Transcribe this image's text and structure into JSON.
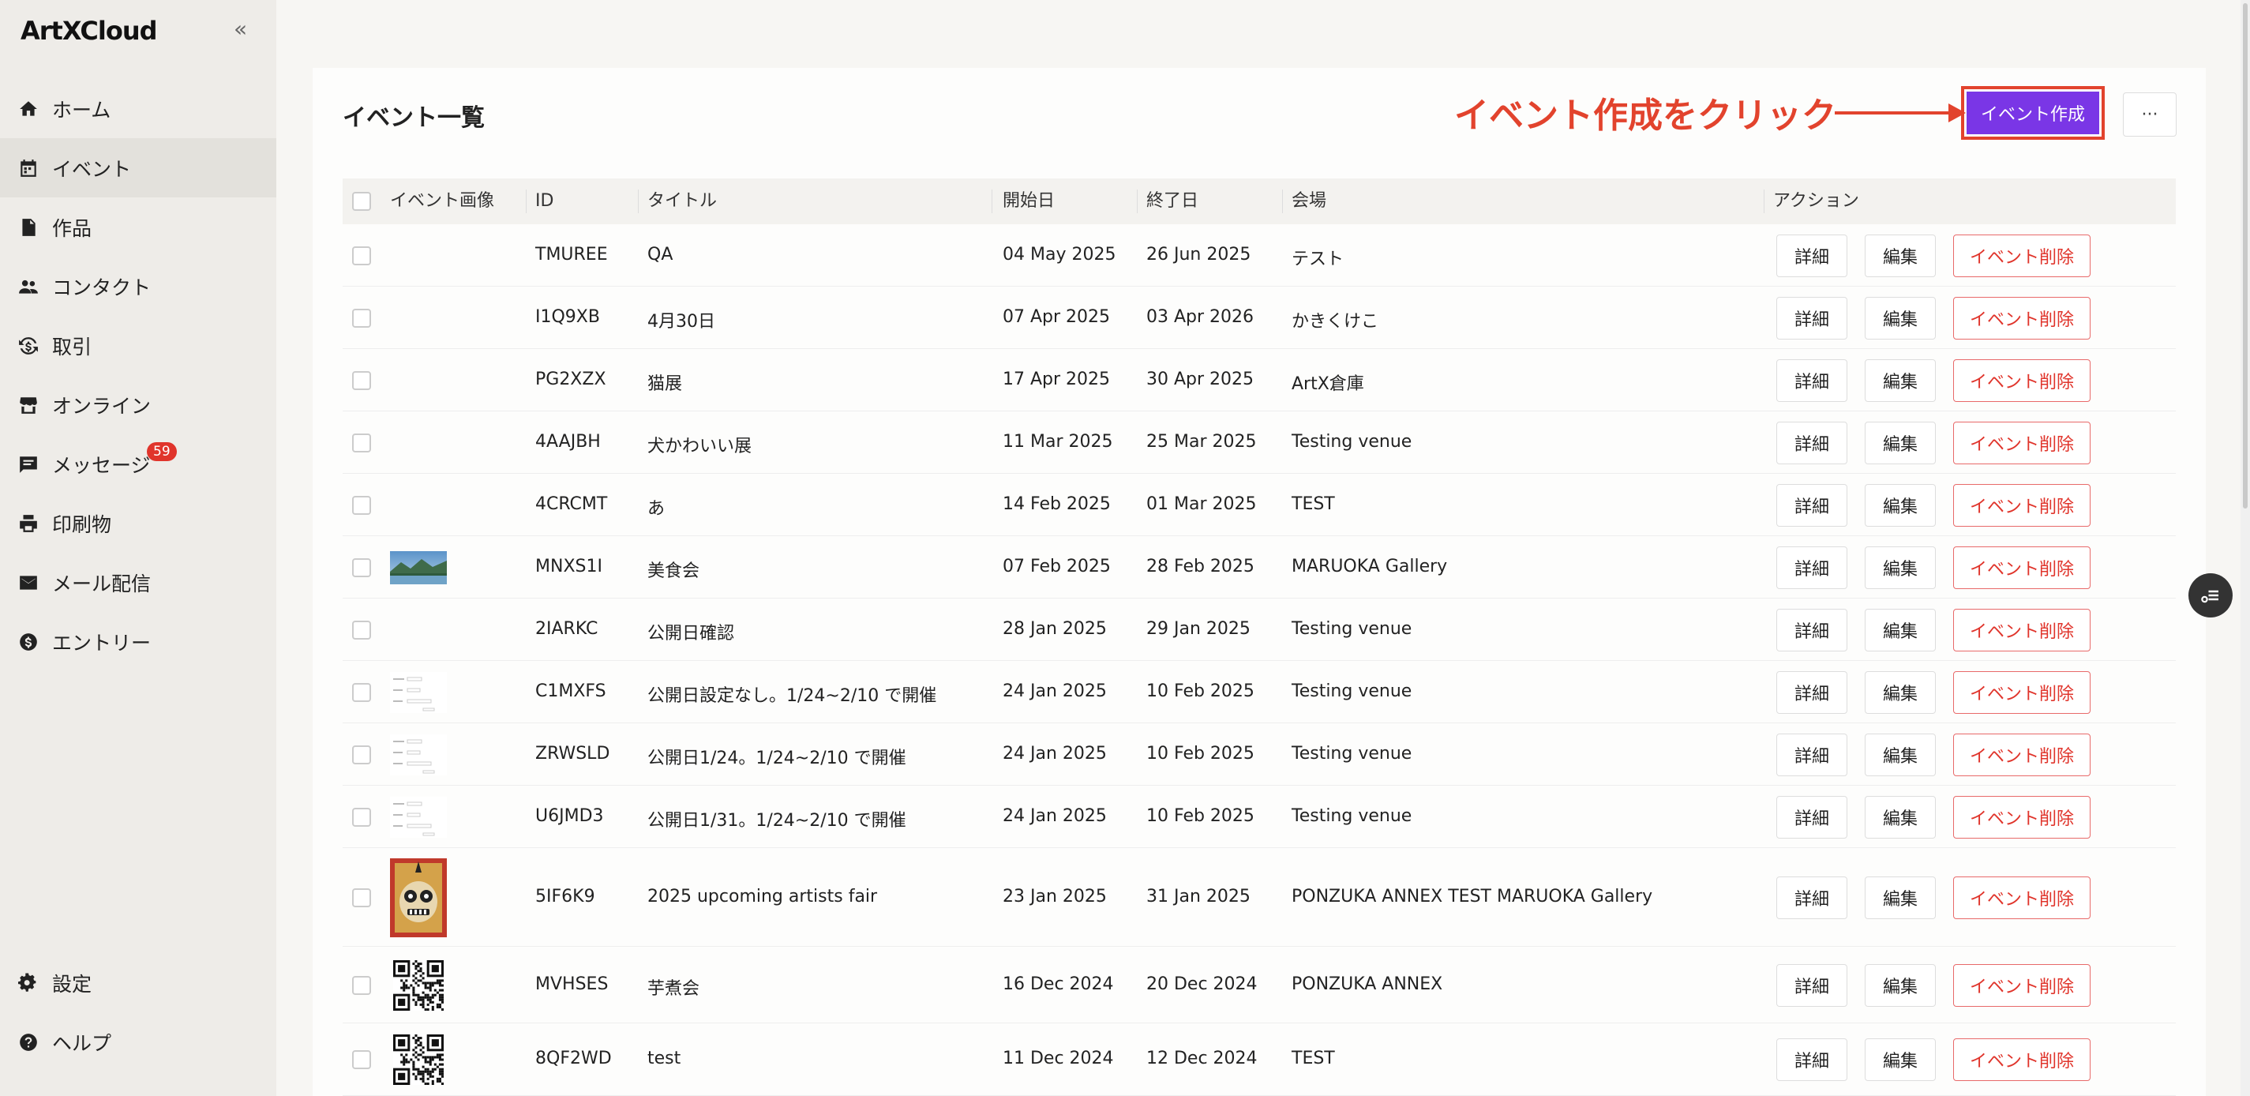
{
  "app": {
    "logo": "ArtXCloud",
    "collapse_glyph": "«"
  },
  "sidebar": {
    "items": [
      {
        "label": "ホーム",
        "icon": "home-icon"
      },
      {
        "label": "イベント",
        "icon": "calendar-icon",
        "active": true
      },
      {
        "label": "作品",
        "icon": "document-icon"
      },
      {
        "label": "コンタクト",
        "icon": "people-icon"
      },
      {
        "label": "取引",
        "icon": "exchange-icon"
      },
      {
        "label": "オンライン",
        "icon": "storefront-icon"
      },
      {
        "label": "メッセージ",
        "icon": "chat-icon",
        "badge": "59"
      },
      {
        "label": "印刷物",
        "icon": "printer-icon"
      },
      {
        "label": "メール配信",
        "icon": "mail-icon"
      },
      {
        "label": "エントリー",
        "icon": "dollar-icon"
      }
    ],
    "bottom": [
      {
        "label": "設定",
        "icon": "gear-icon"
      },
      {
        "label": "ヘルプ",
        "icon": "help-icon"
      }
    ]
  },
  "page": {
    "title": "イベント一覧",
    "annotation": "イベント作成をクリック",
    "create_button": "イベント作成",
    "more_button": "···"
  },
  "table": {
    "headers": {
      "image": "イベント画像",
      "id": "ID",
      "title": "タイトル",
      "start": "開始日",
      "end": "終了日",
      "venue": "会場",
      "action": "アクション"
    },
    "actions": {
      "detail": "詳細",
      "edit": "編集",
      "delete": "イベント削除"
    },
    "rows": [
      {
        "id": "TMUREE",
        "title": "QA",
        "start": "04 May 2025",
        "end": "26 Jun 2025",
        "venue": "テスト",
        "thumb": "none"
      },
      {
        "id": "I1Q9XB",
        "title": "4月30日",
        "start": "07 Apr 2025",
        "end": "03 Apr 2026",
        "venue": "かきくけこ",
        "thumb": "none"
      },
      {
        "id": "PG2XZX",
        "title": "猫展",
        "start": "17 Apr 2025",
        "end": "30 Apr 2025",
        "venue": "ArtX倉庫",
        "thumb": "none"
      },
      {
        "id": "4AAJBH",
        "title": "犬かわいい展",
        "start": "11 Mar 2025",
        "end": "25 Mar 2025",
        "venue": "Testing venue",
        "thumb": "none"
      },
      {
        "id": "4CRCMT",
        "title": "あ",
        "start": "14 Feb 2025",
        "end": "01 Mar 2025",
        "venue": "TEST",
        "thumb": "none"
      },
      {
        "id": "MNXS1I",
        "title": "美食会",
        "start": "07 Feb 2025",
        "end": "28 Feb 2025",
        "venue": "MARUOKA Gallery",
        "thumb": "landscape"
      },
      {
        "id": "2IARKC",
        "title": "公開日確認",
        "start": "28 Jan 2025",
        "end": "29 Jan 2025",
        "venue": "Testing venue",
        "thumb": "none"
      },
      {
        "id": "C1MXFS",
        "title": "公開日設定なし。1/24~2/10 で開催",
        "start": "24 Jan 2025",
        "end": "10 Feb 2025",
        "venue": "Testing venue",
        "thumb": "form"
      },
      {
        "id": "ZRWSLD",
        "title": "公開日1/24。1/24~2/10 で開催",
        "start": "24 Jan 2025",
        "end": "10 Feb 2025",
        "venue": "Testing venue",
        "thumb": "form"
      },
      {
        "id": "U6JMD3",
        "title": "公開日1/31。1/24~2/10 で開催",
        "start": "24 Jan 2025",
        "end": "10 Feb 2025",
        "venue": "Testing venue",
        "thumb": "form"
      },
      {
        "id": "5IF6K9",
        "title": "2025 upcoming artists fair",
        "start": "23 Jan 2025",
        "end": "31 Jan 2025",
        "venue": "PONZUKA ANNEX TEST MARUOKA Gallery",
        "thumb": "mask"
      },
      {
        "id": "MVHSES",
        "title": "芋煮会",
        "start": "16 Dec 2024",
        "end": "20 Dec 2024",
        "venue": "PONZUKA ANNEX",
        "thumb": "qr"
      },
      {
        "id": "8QF2WD",
        "title": "test",
        "start": "11 Dec 2024",
        "end": "12 Dec 2024",
        "venue": "TEST",
        "thumb": "qr"
      }
    ]
  },
  "colors": {
    "accent": "#7a36e6",
    "annotation": "#e2432d",
    "delete": "#e0342b",
    "badge": "#e0342b"
  }
}
